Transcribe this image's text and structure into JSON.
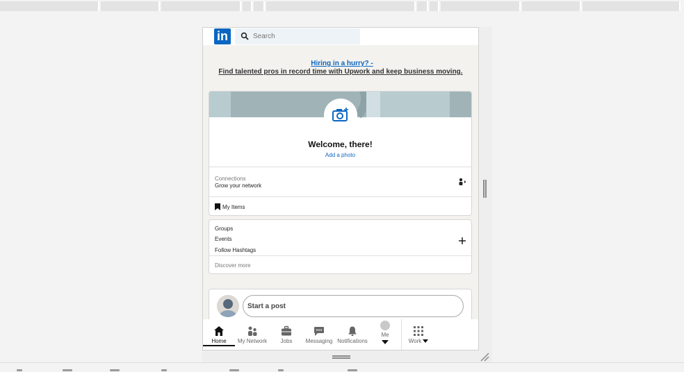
{
  "header": {
    "logo_text": "in",
    "search_placeholder": "Search"
  },
  "ad": {
    "line1": "Hiring in a hurry? -",
    "line2": "Find talented pros in record time with Upwork and keep business moving."
  },
  "profile": {
    "welcome": "Welcome, there!",
    "add_photo": "Add a photo",
    "connections_label": "Connections",
    "connections_action": "Grow your network",
    "my_items": "My Items"
  },
  "groups_card": {
    "groups": "Groups",
    "events": "Events",
    "follow_hashtags": "Follow Hashtags",
    "discover_more": "Discover more"
  },
  "post": {
    "start_label": "Start a post"
  },
  "nav": {
    "home": "Home",
    "my_network": "My Network",
    "jobs": "Jobs",
    "messaging": "Messaging",
    "notifications": "Notifications",
    "me": "Me",
    "work": "Work"
  },
  "colors": {
    "brand": "#0a66c2",
    "banner": "#a0b4b8",
    "background": "#f3f2ef"
  }
}
